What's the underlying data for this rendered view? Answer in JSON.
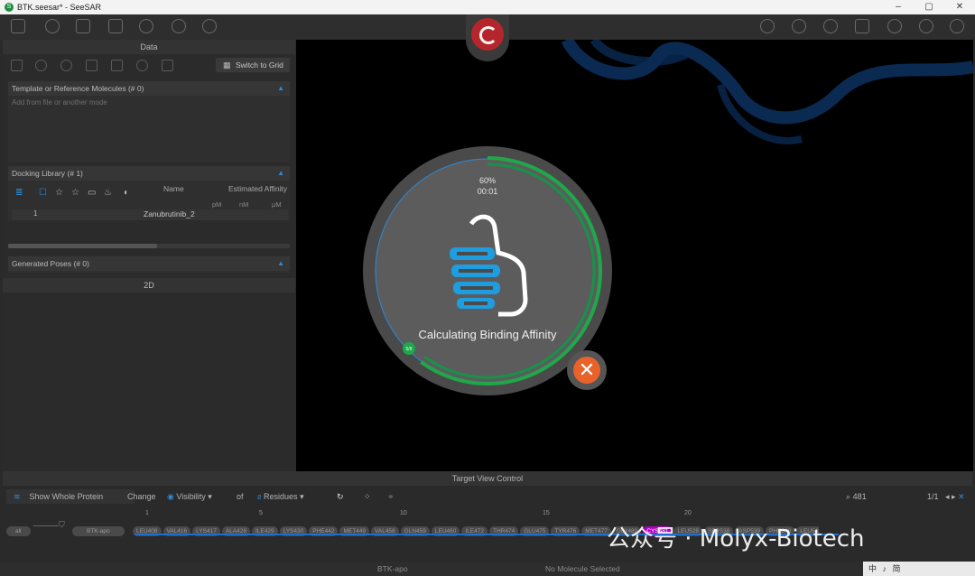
{
  "window": {
    "title": "BTK.seesar* - SeeSAR",
    "controls": [
      "–",
      "▢",
      "✕"
    ]
  },
  "left_panel": {
    "header": "Data",
    "switch_label": "Switch to Grid",
    "template_section": {
      "title": "Template or Reference Molecules  (# 0)",
      "placeholder": "Add from file or another mode"
    },
    "docking_section": {
      "title": "Docking Library  (# 1)",
      "col_name": "Name",
      "col_affinity": "Estimated Affinity",
      "units": [
        "pM",
        "nM",
        "µM"
      ],
      "rows": [
        {
          "index": "1",
          "name": "Zanubrutinib_2"
        }
      ]
    },
    "generated_section": {
      "title": "Generated Poses  (# 0)"
    },
    "footer": "2D"
  },
  "progress": {
    "percent_text": "60%",
    "time_text": "00:01",
    "fraction": 0.6,
    "step_badge": "5/9",
    "label": "Calculating Binding Affinity"
  },
  "target_view": {
    "header": "Target View Control",
    "show_whole_protein": "Show Whole Protein",
    "change": "Change",
    "visibility": "Visibility",
    "of": "of",
    "residues": "Residues",
    "search_value": "481",
    "page_text": "1/1",
    "all_label": "all",
    "protein_label": "BTK-apo",
    "ruler": [
      "1",
      "5",
      "10",
      "15",
      "20"
    ],
    "residue_pills": [
      "LEU408",
      "VAL416",
      "LYS417",
      "ALA428",
      "ILE429",
      "LYS430",
      "PHE442",
      "MET449",
      "VAL458",
      "GLN459",
      "LEU460",
      "ILE472",
      "THR474",
      "GLU475",
      "TYR476",
      "MET477",
      "GLY480",
      "CYS481",
      "LEU528",
      "SER538",
      "ASP539",
      "PHE540",
      "LEU542"
    ]
  },
  "status": {
    "left": "BTK-apo",
    "right": "No Molecule Selected",
    "ime": "中 ♪ 简"
  },
  "watermark": "公众号 · Molyx-Biotech",
  "colors": {
    "accent": "#2e8bd6",
    "progress": "#1fa84a",
    "cancel": "#e8622a",
    "logo": "#b5262c",
    "highlight": "#b000c0"
  }
}
